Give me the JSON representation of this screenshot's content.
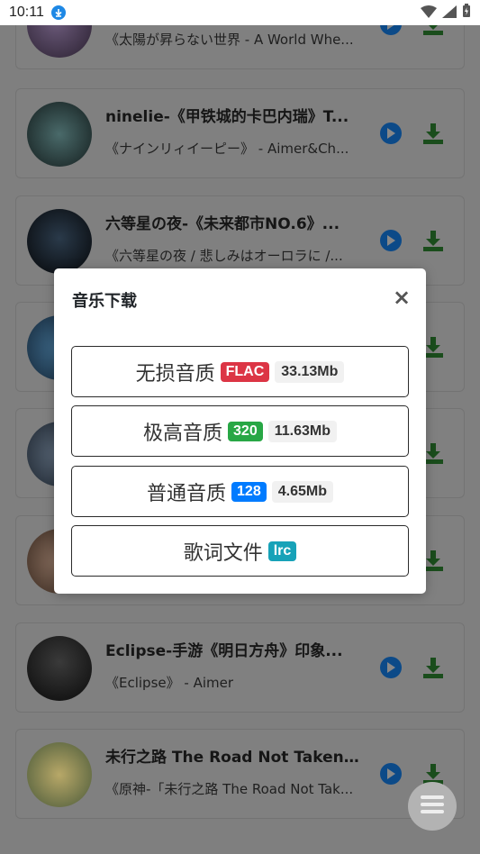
{
  "status_bar": {
    "time": "10:11"
  },
  "songs": [
    {
      "title": "",
      "subtitle": "《太陽が昇らない世界 - A World Whe...",
      "cover_color": "#3c3140"
    },
    {
      "title": "ninelie-《甲铁城的卡巴内瑞》T...",
      "subtitle": "《ナインリィイーピー》 - Aimer&Ch...",
      "cover_color": "#1e2b2a"
    },
    {
      "title": "六等星の夜-《未来都市NO.6》...",
      "subtitle": "《六等星の夜 / 悲しみはオーロラに /...",
      "cover_color": "#0c0f14"
    },
    {
      "title": "",
      "subtitle": "",
      "cover_color": "#2a4a66"
    },
    {
      "title": "",
      "subtitle": "",
      "cover_color": "#3a4450"
    },
    {
      "title": "",
      "subtitle": "",
      "cover_color": "#5a4a3a"
    },
    {
      "title": "Eclipse-手游《明日方舟》印象...",
      "subtitle": "《Eclipse》 - Aimer",
      "cover_color": "#141414"
    },
    {
      "title": "未行之路 The Road Not Taken-...",
      "subtitle": "《原神-「未行之路 The Road Not Tak...",
      "cover_color": "#8a7a3a"
    }
  ],
  "modal": {
    "title": "音乐下载",
    "close": "×",
    "options": [
      {
        "label": "无损音质",
        "badge": "FLAC",
        "badge_color": "#dc3545",
        "size": "33.13Mb"
      },
      {
        "label": "极高音质",
        "badge": "320",
        "badge_color": "#28a745",
        "size": "11.63Mb"
      },
      {
        "label": "普通音质",
        "badge": "128",
        "badge_color": "#007bff",
        "size": "4.65Mb"
      },
      {
        "label": "歌词文件",
        "badge": "lrc",
        "badge_color": "#17a2b8",
        "size": ""
      }
    ]
  },
  "icons": {
    "play": "play-icon",
    "download": "download-icon",
    "menu": "menu-icon"
  },
  "colors": {
    "play": "#1565c0",
    "download": "#2e7d32"
  }
}
